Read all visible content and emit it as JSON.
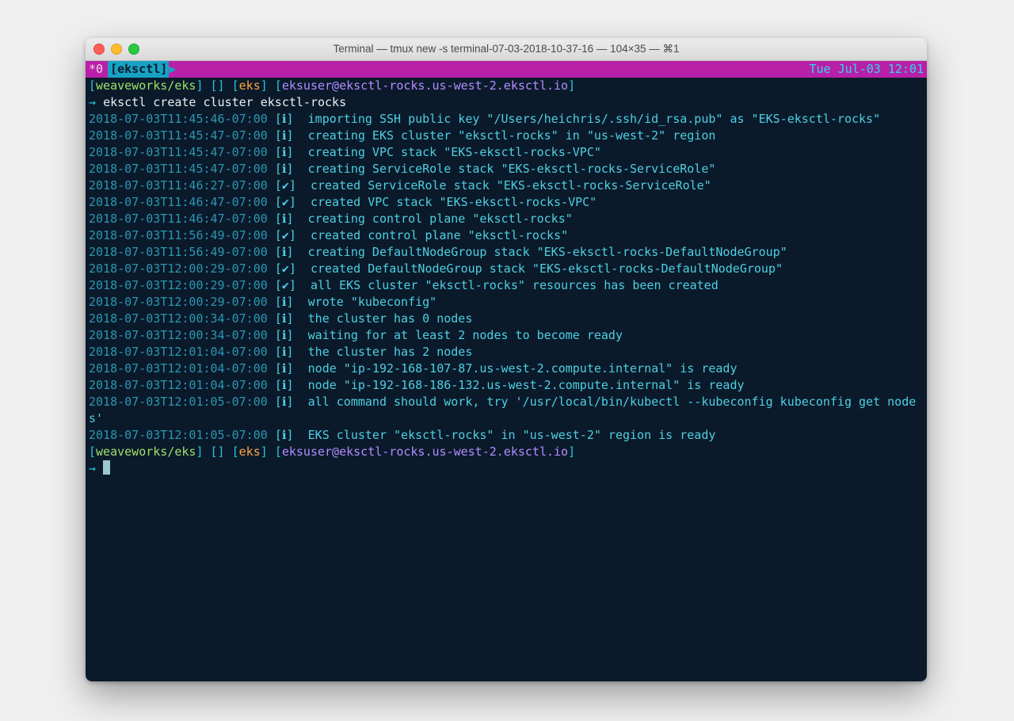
{
  "window": {
    "title": "Terminal — tmux new -s terminal-07-03-2018-10-37-16 — 104×35 — ⌘1"
  },
  "tmux": {
    "left": "*0",
    "tab": "[eksctl]",
    "time": "Tue Jul-03 12:01"
  },
  "ps1": {
    "lbrak": "[",
    "rbrak": "]",
    "repo": "weaveworks/eks",
    "ctx": "eks",
    "userhost": "eksuser@eksctl-rocks.us-west-2.eksctl.io",
    "arrow": "→"
  },
  "cmd": "eksctl create cluster eksctl-rocks",
  "lines": [
    {
      "ts": "2018-07-03T11:45:46-07:00",
      "lvl": "ℹ",
      "msg": "importing SSH public key \"/Users/heichris/.ssh/id_rsa.pub\" as \"EKS-eksctl-rocks\""
    },
    {
      "ts": "2018-07-03T11:45:47-07:00",
      "lvl": "ℹ",
      "msg": "creating EKS cluster \"eksctl-rocks\" in \"us-west-2\" region"
    },
    {
      "ts": "2018-07-03T11:45:47-07:00",
      "lvl": "ℹ",
      "msg": "creating VPC stack \"EKS-eksctl-rocks-VPC\""
    },
    {
      "ts": "2018-07-03T11:45:47-07:00",
      "lvl": "ℹ",
      "msg": "creating ServiceRole stack \"EKS-eksctl-rocks-ServiceRole\""
    },
    {
      "ts": "2018-07-03T11:46:27-07:00",
      "lvl": "✔",
      "msg": "created ServiceRole stack \"EKS-eksctl-rocks-ServiceRole\""
    },
    {
      "ts": "2018-07-03T11:46:47-07:00",
      "lvl": "✔",
      "msg": "created VPC stack \"EKS-eksctl-rocks-VPC\""
    },
    {
      "ts": "2018-07-03T11:46:47-07:00",
      "lvl": "ℹ",
      "msg": "creating control plane \"eksctl-rocks\""
    },
    {
      "ts": "2018-07-03T11:56:49-07:00",
      "lvl": "✔",
      "msg": "created control plane \"eksctl-rocks\""
    },
    {
      "ts": "2018-07-03T11:56:49-07:00",
      "lvl": "ℹ",
      "msg": "creating DefaultNodeGroup stack \"EKS-eksctl-rocks-DefaultNodeGroup\""
    },
    {
      "ts": "2018-07-03T12:00:29-07:00",
      "lvl": "✔",
      "msg": "created DefaultNodeGroup stack \"EKS-eksctl-rocks-DefaultNodeGroup\""
    },
    {
      "ts": "2018-07-03T12:00:29-07:00",
      "lvl": "✔",
      "msg": "all EKS cluster \"eksctl-rocks\" resources has been created"
    },
    {
      "ts": "2018-07-03T12:00:29-07:00",
      "lvl": "ℹ",
      "msg": "wrote \"kubeconfig\""
    },
    {
      "ts": "2018-07-03T12:00:34-07:00",
      "lvl": "ℹ",
      "msg": "the cluster has 0 nodes"
    },
    {
      "ts": "2018-07-03T12:00:34-07:00",
      "lvl": "ℹ",
      "msg": "waiting for at least 2 nodes to become ready"
    },
    {
      "ts": "2018-07-03T12:01:04-07:00",
      "lvl": "ℹ",
      "msg": "the cluster has 2 nodes"
    },
    {
      "ts": "2018-07-03T12:01:04-07:00",
      "lvl": "ℹ",
      "msg": "node \"ip-192-168-107-87.us-west-2.compute.internal\" is ready"
    },
    {
      "ts": "2018-07-03T12:01:04-07:00",
      "lvl": "ℹ",
      "msg": "node \"ip-192-168-186-132.us-west-2.compute.internal\" is ready"
    },
    {
      "ts": "2018-07-03T12:01:05-07:00",
      "lvl": "ℹ",
      "msg": "all command should work, try '/usr/local/bin/kubectl --kubeconfig kubeconfig get nodes'"
    },
    {
      "ts": "2018-07-03T12:01:05-07:00",
      "lvl": "ℹ",
      "msg": "EKS cluster \"eksctl-rocks\" in \"us-west-2\" region is ready"
    }
  ]
}
